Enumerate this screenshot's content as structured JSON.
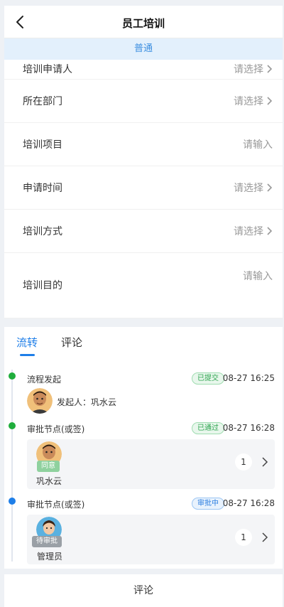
{
  "header": {
    "title": "员工培训",
    "back_icon": "chevron-left-icon"
  },
  "banner": {
    "text": "普通"
  },
  "form": {
    "rows": [
      {
        "label": "培训申请人",
        "value": "请选择",
        "arrow": true
      },
      {
        "label": "所在部门",
        "value": "请选择",
        "arrow": true
      },
      {
        "label": "培训项目",
        "value": "请输入",
        "arrow": false
      },
      {
        "label": "申请时间",
        "value": "请选择",
        "arrow": true
      },
      {
        "label": "培训方式",
        "value": "请选择",
        "arrow": true
      },
      {
        "label": "培训目的",
        "value": "请输入",
        "arrow": false
      }
    ]
  },
  "tabs": [
    {
      "label": "流转"
    },
    {
      "label": "评论"
    }
  ],
  "timeline": {
    "nodes": [
      {
        "title": "流程发起",
        "status": "已提交",
        "status_color": "#2ea44f",
        "time": "08-27 16:25",
        "starter_text": "发起人：巩水云",
        "dot_color": "#1fad3c"
      },
      {
        "title": "审批节点(或签)",
        "status": "已通过",
        "status_color": "#2ea44f",
        "time": "08-27 16:28",
        "approver": "巩水云",
        "approver_tag": "同意",
        "count": "1",
        "dot_color": "#1fad3c"
      },
      {
        "title": "审批节点(或签)",
        "status": "审批中",
        "status_color": "#2a7de0",
        "time": "08-27 16:28",
        "approver": "管理员",
        "approver_tag": "待审批",
        "count": "1",
        "dot_color": "#1e7ee8"
      }
    ]
  },
  "bottom": {
    "label": "评论"
  }
}
